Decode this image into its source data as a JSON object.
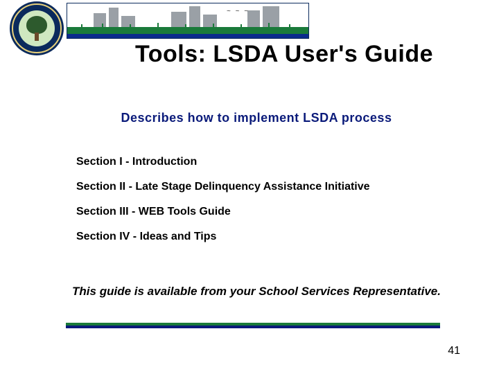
{
  "title": "Tools: LSDA User's Guide",
  "subtitle": "Describes how to implement LSDA process",
  "sections": [
    "Section I - Introduction",
    "Section II - Late Stage Delinquency Assistance Initiative",
    "Section III - WEB Tools Guide",
    "Section IV - Ideas and Tips"
  ],
  "footer_note": "This guide is available from your School Services Representative.",
  "page_number": "41"
}
